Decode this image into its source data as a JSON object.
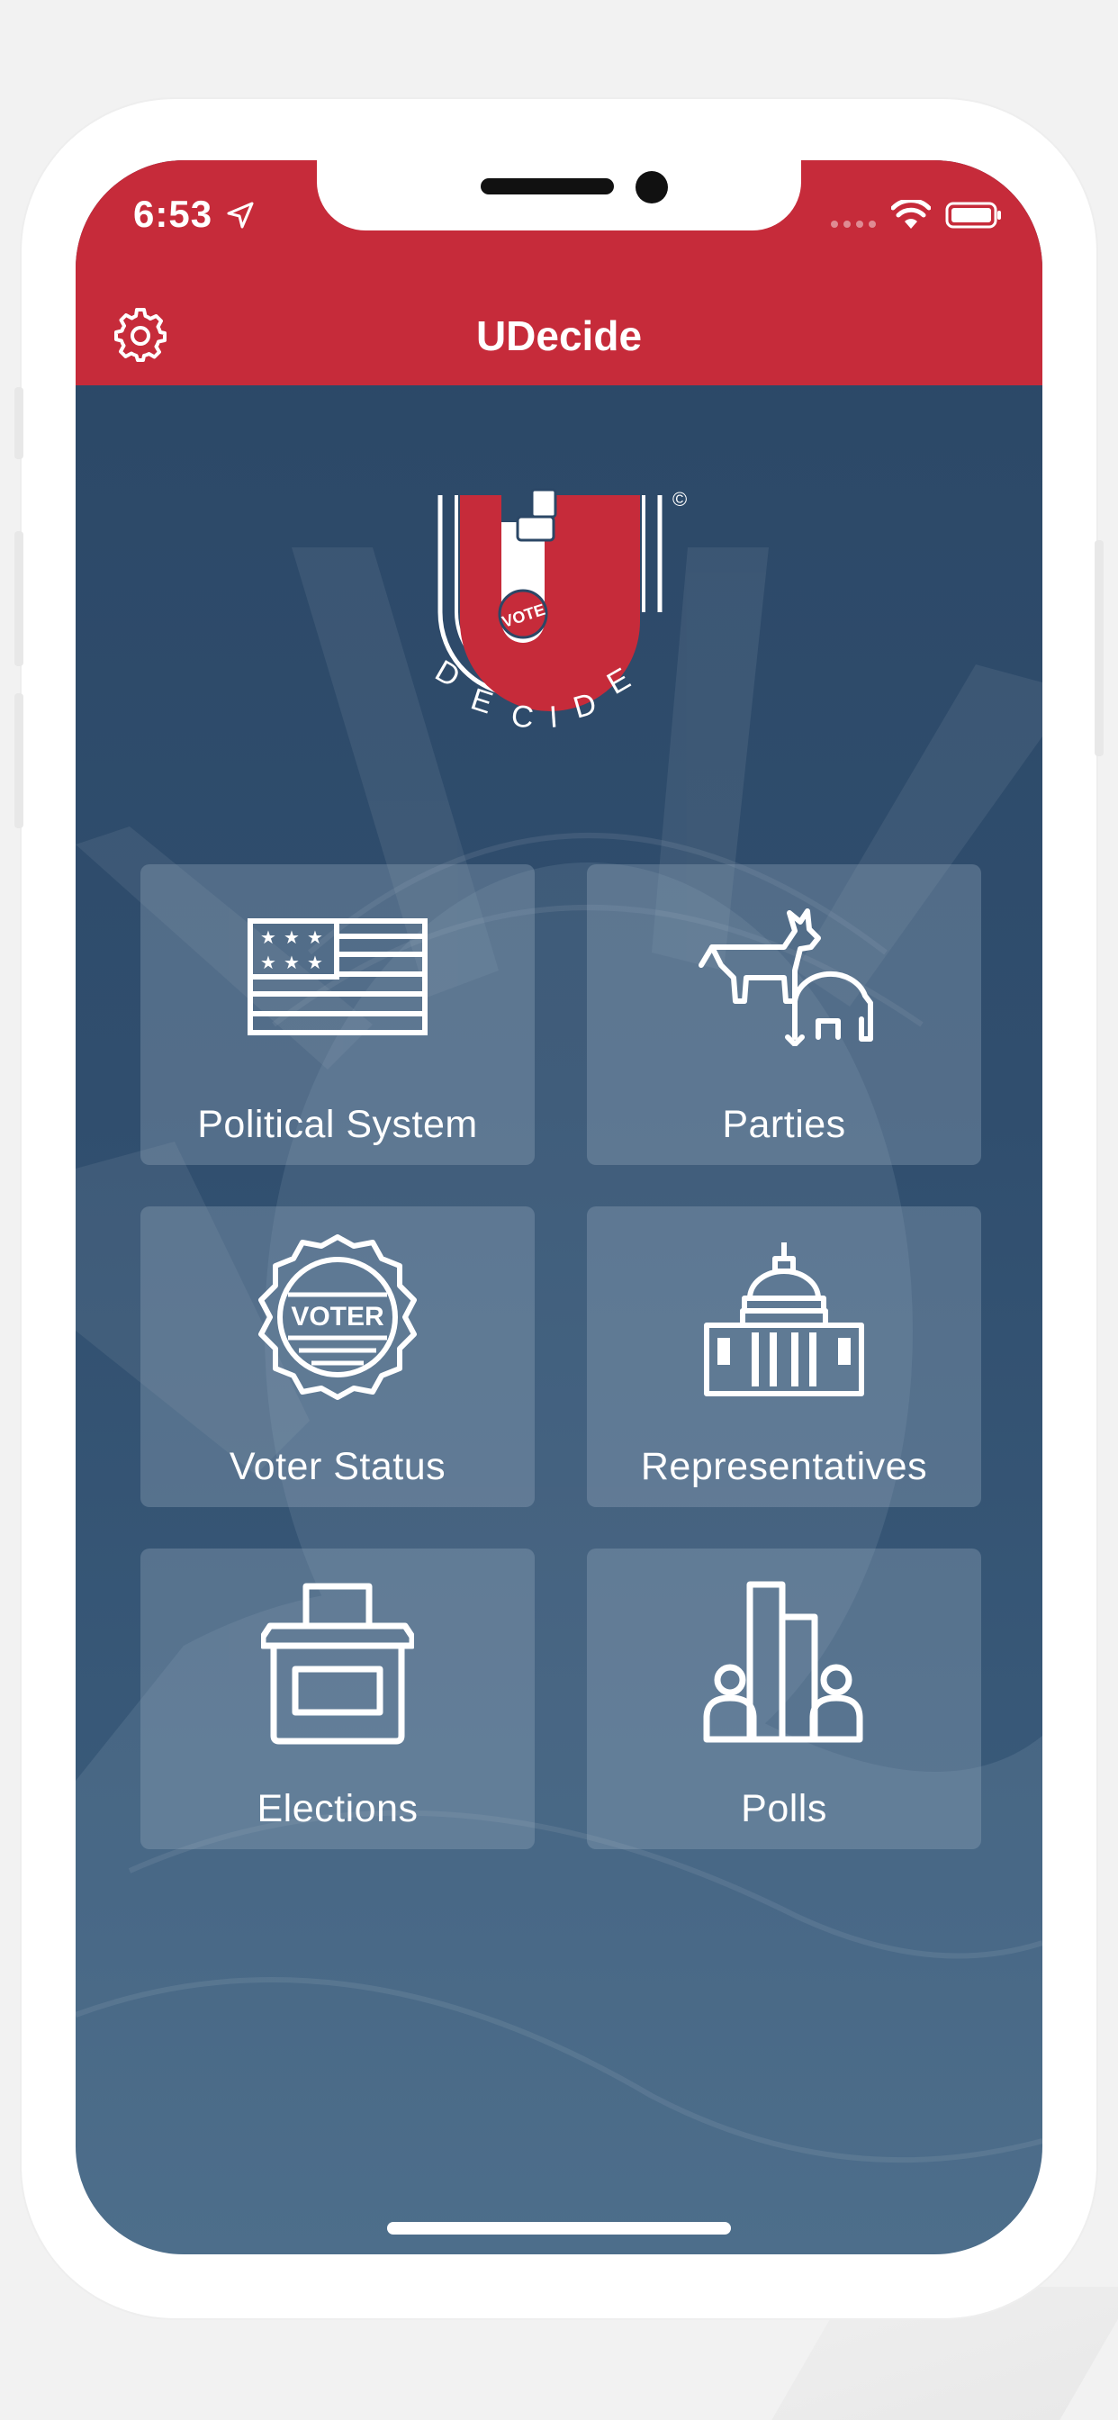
{
  "status_bar": {
    "time": "6:53"
  },
  "nav": {
    "title": "UDecide",
    "settings_icon": "gear-icon"
  },
  "logo": {
    "vote_text": "VOTE",
    "decide_text": "DECIDE",
    "copyright": "©"
  },
  "tiles": [
    {
      "label": "Political System",
      "icon": "flag-icon"
    },
    {
      "label": "Parties",
      "icon": "donkey-elephant-icon"
    },
    {
      "label": "Voter Status",
      "icon": "voter-badge-icon",
      "badge_text": "VOTER"
    },
    {
      "label": "Representatives",
      "icon": "capitol-icon"
    },
    {
      "label": "Elections",
      "icon": "ballot-box-icon"
    },
    {
      "label": "Polls",
      "icon": "poll-chart-icon"
    }
  ],
  "colors": {
    "brand_red": "#c62b3a",
    "navy": "#2b4766",
    "tile": "#96aabe"
  }
}
